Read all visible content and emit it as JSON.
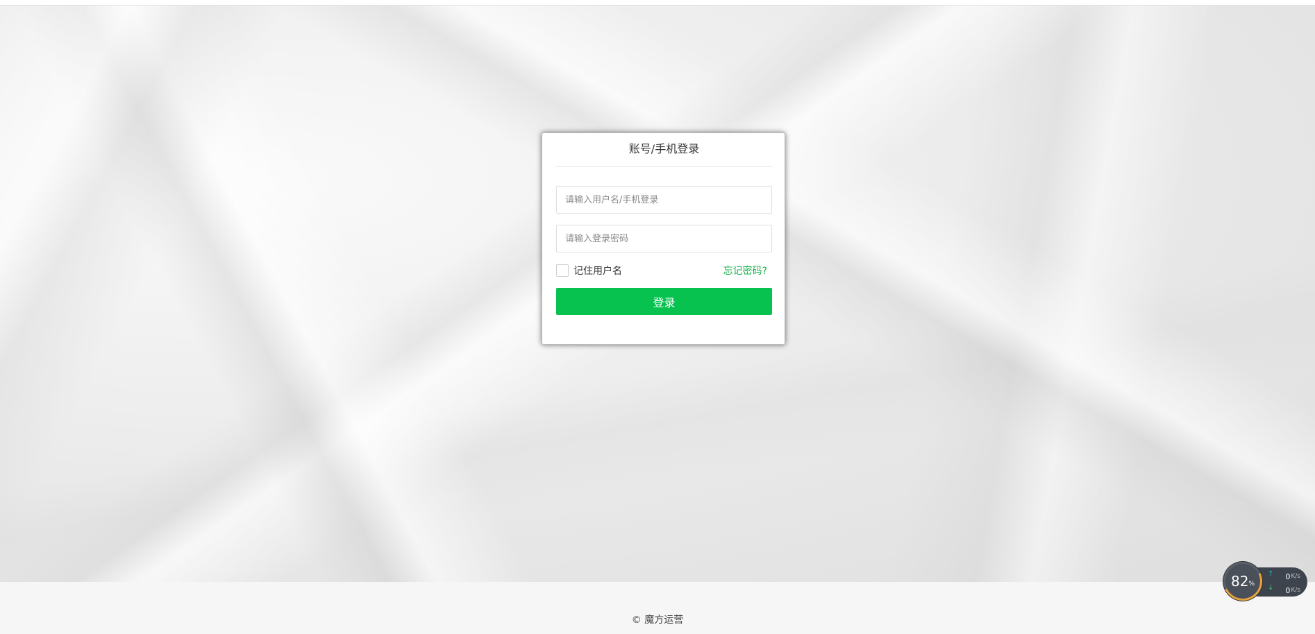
{
  "login": {
    "title": "账号/手机登录",
    "username_placeholder": "请输入用户名/手机登录",
    "password_placeholder": "请输入登录密码",
    "remember_label": "记住用户名",
    "forgot_label": "忘记密码?",
    "submit_label": "登录"
  },
  "footer": {
    "copyright": "© 魔方运营"
  },
  "network_widget": {
    "percent": "82",
    "percent_unit": "%",
    "upload_value": "0",
    "download_value": "0",
    "rate_unit": "K/s",
    "upload_arrow": "↑",
    "download_arrow": "↓"
  },
  "colors": {
    "accent_green": "#08c250",
    "link_green": "#16b34a"
  }
}
